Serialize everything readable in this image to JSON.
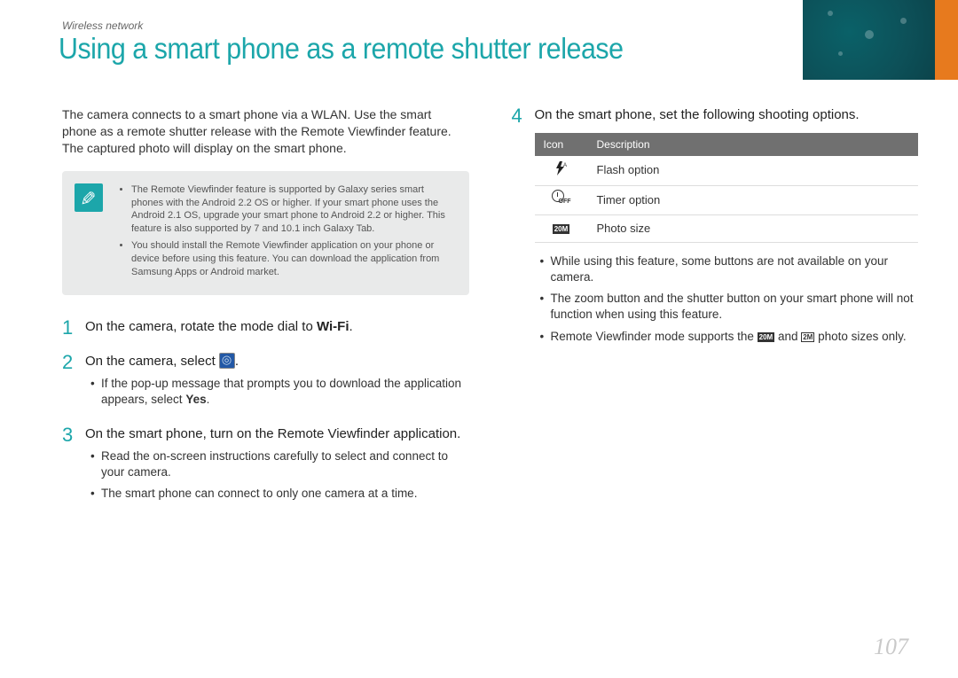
{
  "breadcrumb": "Wireless network",
  "title": "Using a smart phone as a remote shutter release",
  "intro": "The camera connects to a smart phone via a WLAN. Use the smart phone as a remote shutter release with the Remote Viewfinder feature. The captured photo will display on the smart phone.",
  "note": {
    "items": [
      "The Remote Viewfinder feature is supported by Galaxy series smart phones with the Android 2.2 OS or higher. If your smart phone uses the Android 2.1 OS, upgrade your smart phone to Android 2.2 or higher. This feature is also supported by 7 and 10.1 inch Galaxy Tab.",
      "You should install the Remote Viewfinder application on your phone or device before using this feature. You can download the application from Samsung Apps or Android market."
    ]
  },
  "steps": {
    "s1": {
      "num": "1",
      "pre": "On the camera, rotate the mode dial to ",
      "wifi": "Wi-Fi",
      "post": "."
    },
    "s2": {
      "num": "2",
      "pre": "On the camera, select ",
      "post": ".",
      "bullet_pre": "If the pop-up message that prompts you to download the application appears, select ",
      "yes": "Yes",
      "bullet_post": "."
    },
    "s3": {
      "num": "3",
      "title": "On the smart phone, turn on the Remote Viewfinder application.",
      "b1": "Read the on-screen instructions carefully to select and connect to your camera.",
      "b2": "The smart phone can connect to only one camera at a time."
    },
    "s4": {
      "num": "4",
      "title": "On the smart phone, set the following shooting options.",
      "table": {
        "h1": "Icon",
        "h2": "Description",
        "r1": "Flash option",
        "r2": "Timer option",
        "r3": "Photo size"
      },
      "b1": "While using this feature, some buttons are not available on your camera.",
      "b2": "The zoom button and the shutter button on your smart phone will not function when using this feature.",
      "b3_pre": "Remote Viewfinder mode supports the ",
      "b3_mid": " and ",
      "b3_post": " photo sizes only.",
      "size1": "20M",
      "size2": "2M"
    }
  },
  "page_number": "107"
}
